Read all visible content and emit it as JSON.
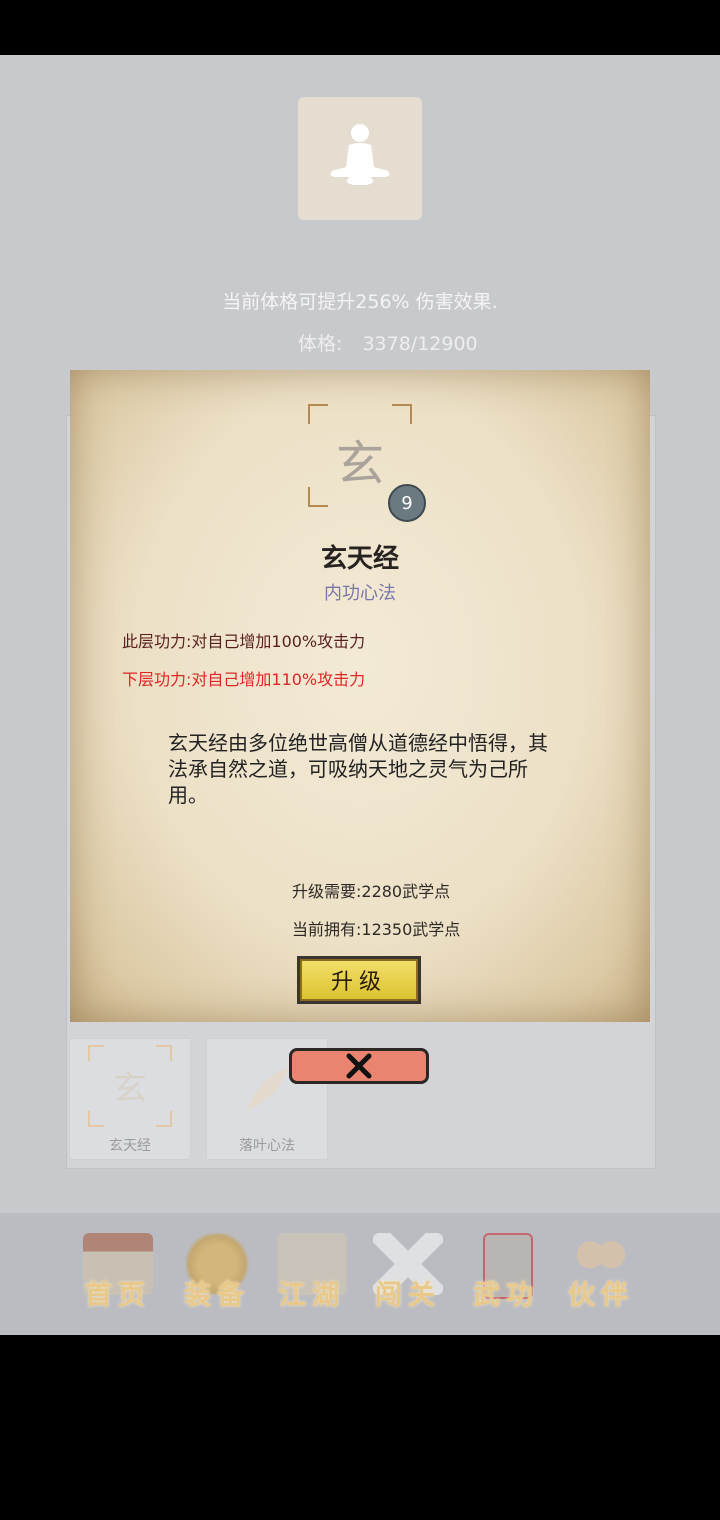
{
  "header": {
    "avatar_icon": "meditating-person-icon",
    "summary": "当前体格可提升256% 伤害效果.",
    "stat_label": "体格:",
    "stat_value": "3378/12900"
  },
  "skill": {
    "emblem_glyph": "玄",
    "level": "9",
    "name": "玄天经",
    "type": "内功心法",
    "current_effect": "此层功力:对自己增加100%攻击力",
    "next_effect": "下层功力:对自己增加110%攻击力",
    "description": "玄天经由多位绝世高僧从道德经中悟得，其法承自然之道，可吸纳天地之灵气为己所用。",
    "upgrade_cost": "升级需要:2280武学点",
    "owned_points": "当前拥有:12350武学点",
    "upgrade_label": "升级"
  },
  "dialog": {
    "close_icon": "close-x-icon"
  },
  "skill_list": [
    {
      "label": "玄天经",
      "glyph": "玄"
    },
    {
      "label": "落叶心法",
      "glyph": ""
    }
  ],
  "nav": [
    {
      "label": "首页",
      "icon": "home-pavilion-icon"
    },
    {
      "label": "装备",
      "icon": "armor-icon"
    },
    {
      "label": "江湖",
      "icon": "map-scroll-icon"
    },
    {
      "label": "闯关",
      "icon": "crossed-swords-icon"
    },
    {
      "label": "武功",
      "icon": "martial-book-icon"
    },
    {
      "label": "伙伴",
      "icon": "companions-icon"
    }
  ],
  "colors": {
    "background": "#c8c9cd",
    "parchment": "#ece0c6",
    "next_effect": "#e02525",
    "upgrade_button": "#e6cd40",
    "close_button": "#e98471"
  }
}
